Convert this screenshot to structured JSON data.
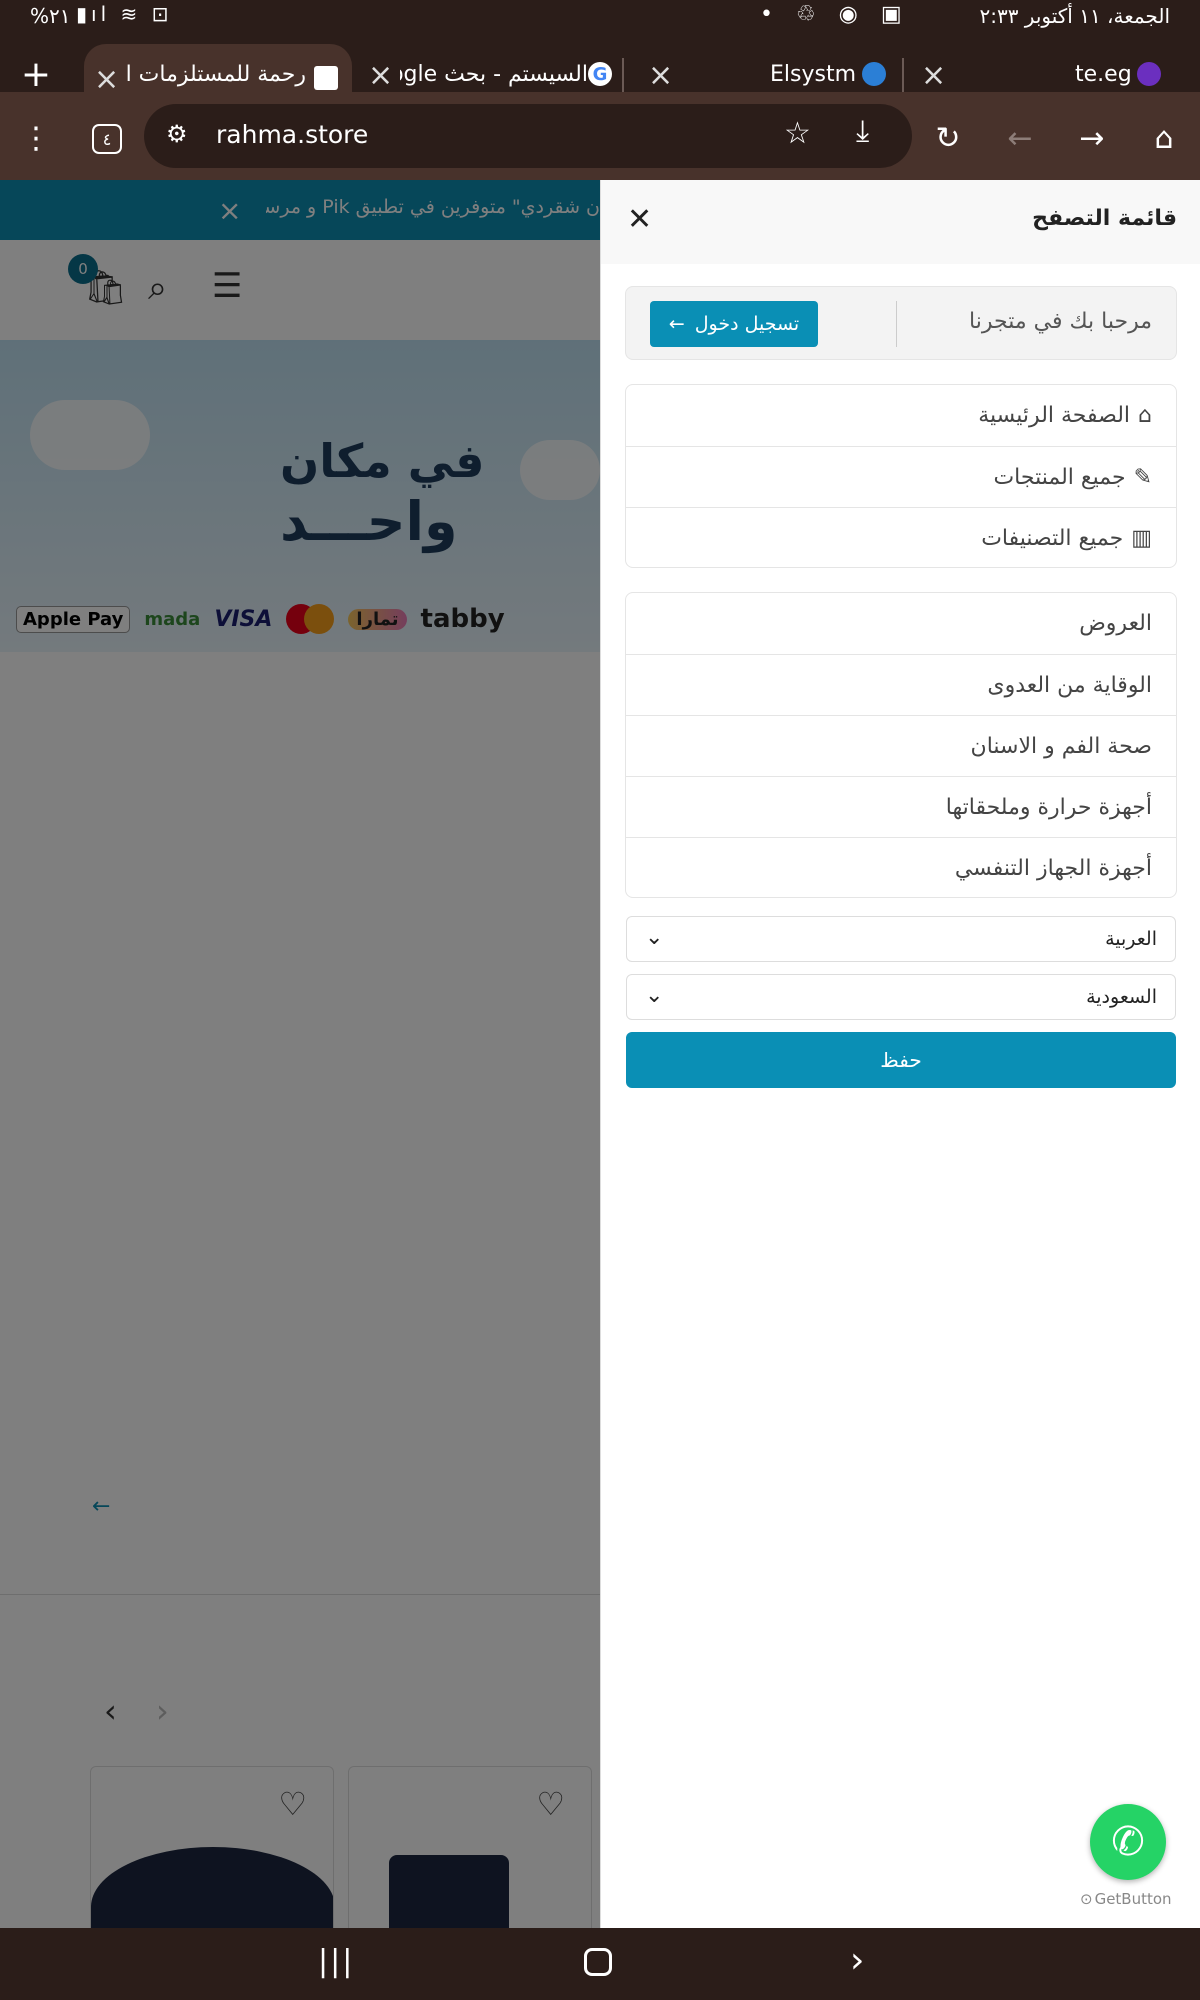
{
  "status_bar": {
    "date_time": "الجمعة، ١١ أكتوبر ٢:٣٣",
    "battery": "%٢١"
  },
  "tabs": [
    {
      "title": "te.eg",
      "favicon": "purple-badge-icon"
    },
    {
      "title": "Elsystm",
      "favicon": "globe-icon"
    },
    {
      "title": "السيستم - بحث Google",
      "favicon": "google-icon"
    },
    {
      "title": "رحمة للمستلزمات الط",
      "favicon": "rahma-icon",
      "active": true
    }
  ],
  "toolbar": {
    "url": "rahma.store",
    "tab_count": "٤"
  },
  "page": {
    "announcement": "ن شقردي\" متوفرين في تطبيق Pik و مرسول",
    "cart_count": "0",
    "banner_line1": "في مكان",
    "banner_line2": "واحـــد",
    "payment_logos": [
      "Apple Pay",
      "mada",
      "VISA",
      "Mastercard",
      "تمارا",
      "tabby"
    ]
  },
  "drawer": {
    "title": "قائمة التصفح",
    "welcome": "مرحبا بك في متجرنا",
    "login_button": "تسجيل دخول",
    "main_links": [
      {
        "label": "الصفحة الرئيسية",
        "icon": "home-icon"
      },
      {
        "label": "جميع المنتجات",
        "icon": "sparkle-icon"
      },
      {
        "label": "جميع التصنيفات",
        "icon": "layout-icon"
      }
    ],
    "categories": [
      "العروض",
      "الوقاية من العدوى",
      "صحة الفم و الاسنان",
      "أجهزة حرارة وملحقاتها",
      "أجهزة الجهاز التنفسي"
    ],
    "language_select": "العربية",
    "country_select": "السعودية",
    "save_button": "حفظ"
  },
  "whatsapp": {
    "credit": "GetButton"
  },
  "colors": {
    "accent": "#0a8fb5",
    "browser_dark": "#2b1d19",
    "browser_toolbar": "#48322b"
  }
}
